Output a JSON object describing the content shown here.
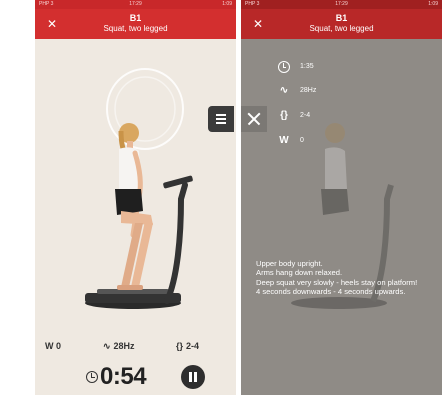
{
  "status_bar": {
    "left": "PHP 3",
    "center": "17:29",
    "right": "1:09"
  },
  "header": {
    "close_icon": "close-icon",
    "number": "B1",
    "subtitle": "Squat, two legged",
    "left_number": "B1",
    "left_subtitle": "Squat, two legged"
  },
  "stats": {
    "weight": "W 0",
    "frequency": "28Hz",
    "reps": "2-4"
  },
  "timer": {
    "value": "0:54",
    "progress": 0.35
  },
  "menu_icon": "menu-icon",
  "close_panel_icon": "close-icon",
  "info": {
    "duration": "1:35",
    "frequency": "28Hz",
    "reps": "2-4",
    "weight": "0"
  },
  "description": [
    "Upper body upright.",
    "Arms hang down relaxed.",
    "Deep squat very slowly - heels stay on platform!",
    "4 seconds downwards - 4 seconds upwards."
  ],
  "colors": {
    "header": "#d32f2f",
    "accent": "#e8753a",
    "dark": "#2e2e2e"
  }
}
